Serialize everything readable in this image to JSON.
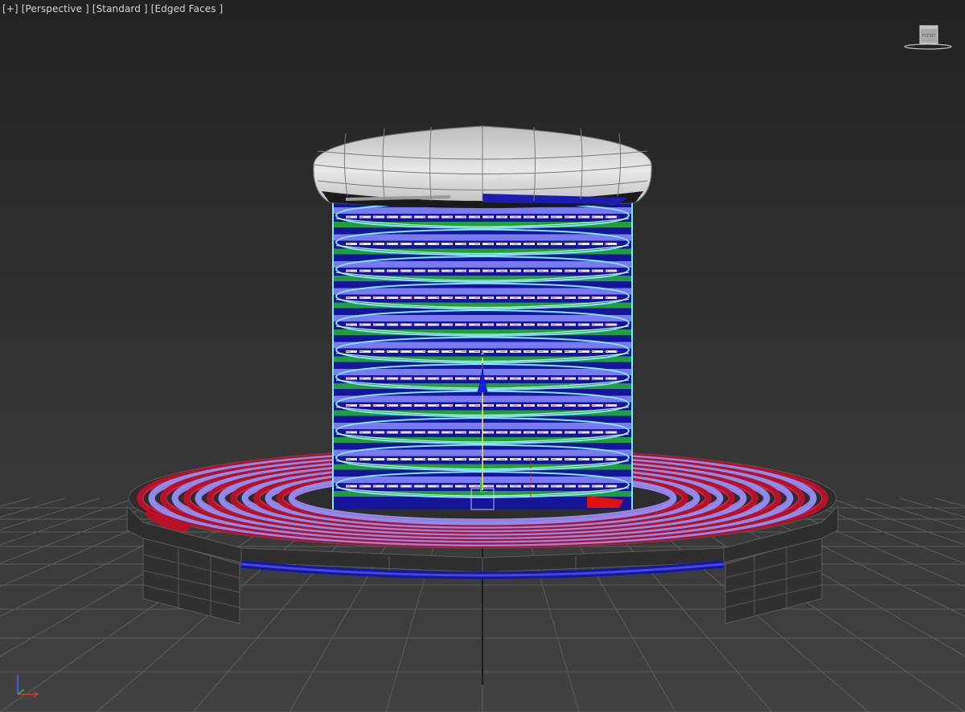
{
  "viewport": {
    "labels": [
      "[+]",
      "[Perspective ]",
      "[Standard ]",
      "[Edged Faces ]"
    ]
  },
  "viewcube": {
    "face_label": "FRONT"
  },
  "gizmo": {
    "axis_label": "z"
  },
  "colors": {
    "background": "#333333",
    "grid": "#5a5a5a",
    "cap": "#cfcfcf",
    "coil_blue": "#1a1ab4",
    "coil_green": "#22a845",
    "spline_cyan": "#7fe8ff",
    "flat_coil_red": "#b5122a",
    "flat_coil_violet": "#8c8cf0",
    "base_dark": "#2b2b2b",
    "selected_red": "#e01010"
  },
  "icons": [
    "viewcube-icon",
    "axis-tripod-icon",
    "move-gizmo-icon"
  ]
}
